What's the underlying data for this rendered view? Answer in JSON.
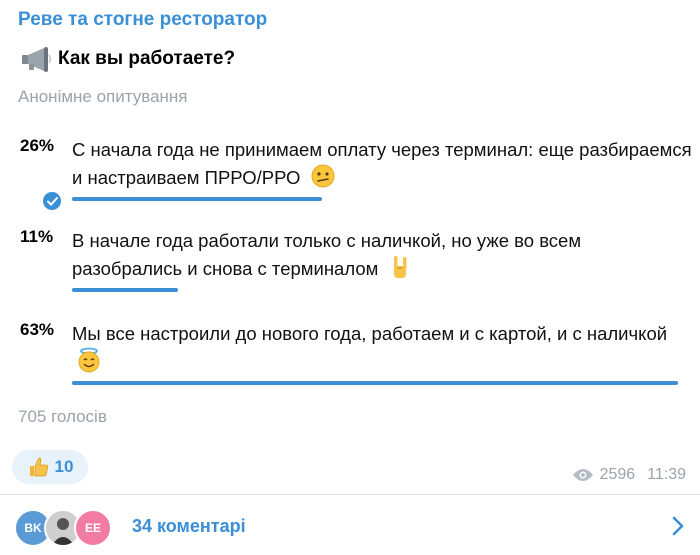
{
  "channel": {
    "name": "Реве та стогне ресторатор"
  },
  "poll": {
    "question": "Как вы работаете?",
    "type": "Анонімне опитування",
    "options": [
      {
        "percent": "26%",
        "text": "С начала года не принимаем оплату через терминал: еще разбираемся и настраиваем ПРРО/РРО",
        "value": 26,
        "emoji": "confused-face-emoji",
        "chosen": true
      },
      {
        "percent": "11%",
        "text": "В начале года работали только с наличкой, но уже во всем разобрались и снова с терминалом",
        "value": 11,
        "emoji": "sign-of-horns-emoji",
        "chosen": false
      },
      {
        "percent": "63%",
        "text": "Мы все настроили до нового года, работаем и с картой, и с наличкой",
        "value": 63,
        "emoji": "smiling-face-with-halo-emoji",
        "chosen": false
      }
    ],
    "votes": "705 голосів"
  },
  "reaction": {
    "icon": "thumbs-up-emoji",
    "count": "10"
  },
  "meta": {
    "views": "2596",
    "time": "11:39"
  },
  "comments": {
    "label": "34 коментарі",
    "avatars": [
      {
        "initials": "BK",
        "color": "#5b9bd5"
      },
      {
        "initials": "",
        "color": "#d9d9d9"
      },
      {
        "initials": "EE",
        "color": "#f27ba4"
      }
    ]
  },
  "colors": {
    "accent": "#3a8fd6",
    "muted": "#9aa2ab"
  }
}
